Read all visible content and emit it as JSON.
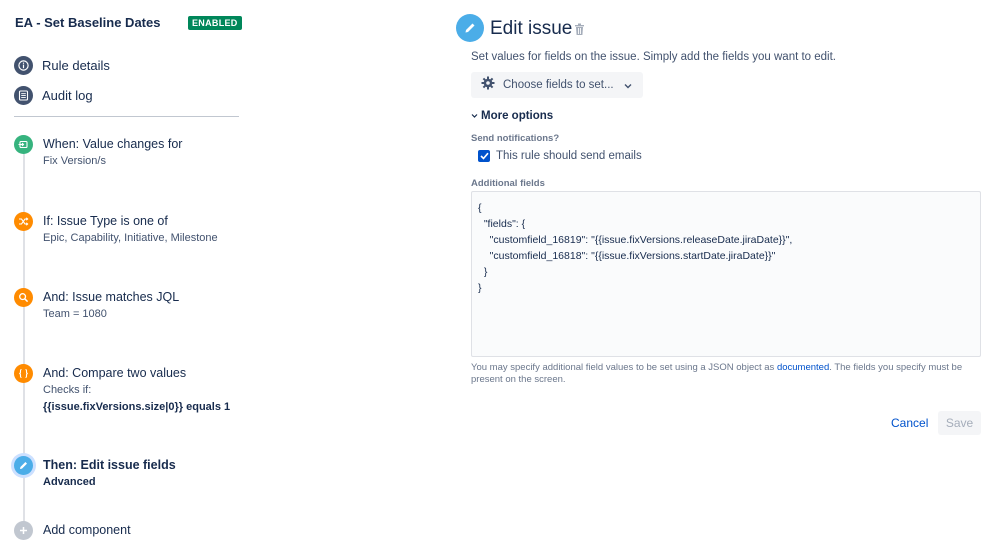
{
  "rule": {
    "title": "EA - Set Baseline Dates",
    "status_badge": "ENABLED"
  },
  "nav": {
    "rule_details": "Rule details",
    "audit_log": "Audit log"
  },
  "steps": [
    {
      "title": "When: Value changes for",
      "subtitle": "Fix Version/s",
      "color": "#36b37e",
      "icon": "trigger-icon"
    },
    {
      "title": "If: Issue Type is one of",
      "subtitle": "Epic, Capability, Initiative, Milestone",
      "color": "#ff8b00",
      "icon": "shuffle-icon"
    },
    {
      "title": "And: Issue matches JQL",
      "subtitle": "Team = 1080",
      "color": "#ff8b00",
      "icon": "search-icon"
    },
    {
      "title": "And: Compare two values",
      "subtitle": "Checks if:",
      "subtitle2": "{{issue.fixVersions.size|0}} equals 1",
      "color": "#ff8b00",
      "icon": "braces-icon"
    },
    {
      "title": "Then: Edit issue fields",
      "subtitle": "Advanced",
      "color": "#4bade8",
      "icon": "pencil-icon"
    }
  ],
  "add_component": "Add component",
  "editor": {
    "title": "Edit issue",
    "description": "Set values for fields on the issue. Simply add the fields you want to edit.",
    "choose_fields": "Choose fields to set...",
    "more_options": "More options",
    "send_notifications_label": "Send notifications?",
    "send_emails_label": "This rule should send emails",
    "send_emails_checked": true,
    "additional_fields_label": "Additional fields",
    "json_lines": [
      "{",
      "  \"fields\": {",
      "    \"customfield_16819\": \"{{issue.fixVersions.releaseDate.jiraDate}}\",",
      "    \"customfield_16818\": \"{{issue.fixVersions.startDate.jiraDate}}\"",
      "  }",
      "}"
    ],
    "help_before": "You may specify additional field values to be set using a JSON object as ",
    "help_link": "documented",
    "help_after": ". The fields you specify must be present on the screen.",
    "cancel_label": "Cancel",
    "save_label": "Save"
  }
}
